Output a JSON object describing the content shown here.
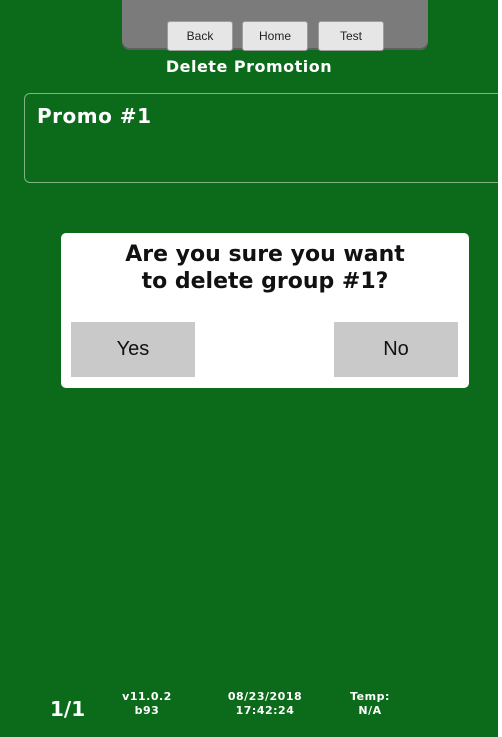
{
  "nav": {
    "back_label": "Back",
    "home_label": "Home",
    "test_label": "Test"
  },
  "page": {
    "title": "Delete Promotion"
  },
  "promo": {
    "name": "Promo #1"
  },
  "dialog": {
    "message_line1": "Are you sure you want",
    "message_line2": "to delete group #1?",
    "yes_label": "Yes",
    "no_label": "No"
  },
  "footer": {
    "page_indicator": "1/1",
    "version": "v11.0.2",
    "build": "b93",
    "date": "08/23/2018",
    "time": "17:42:24",
    "temp_label": "Temp:",
    "temp_value": "N/A"
  }
}
